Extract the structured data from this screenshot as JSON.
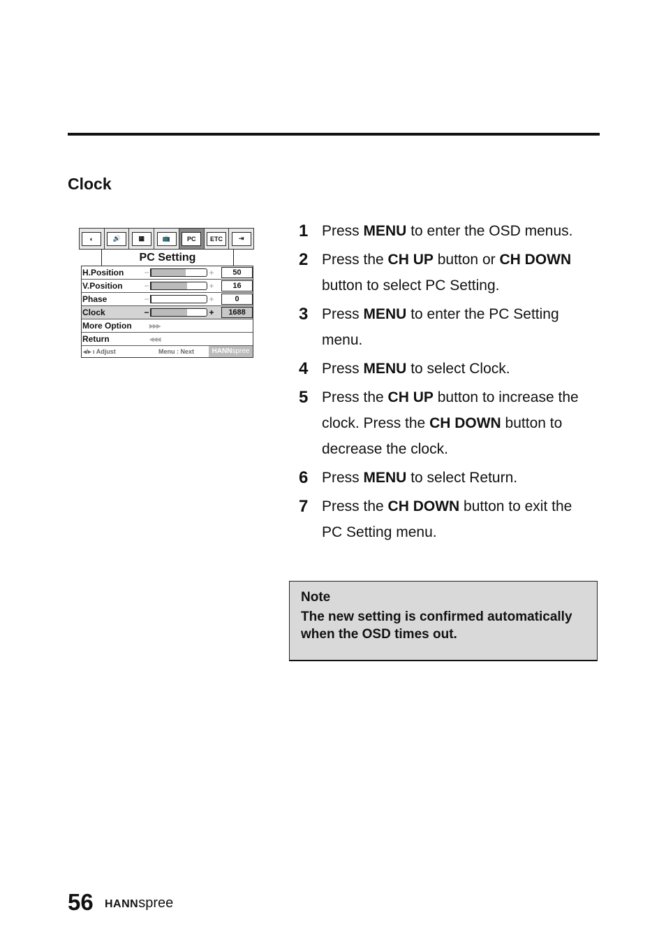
{
  "section_title": "Clock",
  "osd": {
    "tabs": [
      {
        "icon": "brightness-icon",
        "glyph": "◐",
        "active": false
      },
      {
        "icon": "sound-icon",
        "glyph": "🔊",
        "active": false
      },
      {
        "icon": "picture-icon",
        "glyph": "▦",
        "active": false
      },
      {
        "icon": "tv-icon",
        "glyph": "📺",
        "active": false
      },
      {
        "icon": "pc-icon",
        "glyph": "PC",
        "active": true
      },
      {
        "icon": "etc-icon",
        "glyph": "ETC",
        "active": false
      },
      {
        "icon": "exit-icon",
        "glyph": "⇥",
        "active": false
      }
    ],
    "title": "PC Setting",
    "rows": [
      {
        "label": "H.Position",
        "value": "50",
        "fill": 0.62,
        "selected": false
      },
      {
        "label": "V.Position",
        "value": "16",
        "fill": 0.64,
        "selected": false
      },
      {
        "label": "Phase",
        "value": "0",
        "fill": 0.0,
        "selected": false
      },
      {
        "label": "Clock",
        "value": "1688",
        "fill": 0.64,
        "selected": true
      }
    ],
    "more_option": "More Option",
    "return_label": "Return",
    "more_arrows": "▶▶▶",
    "return_arrows": "◀◀◀",
    "footer": {
      "adjust": "◂/▸ ı Adjust",
      "next": "Menu : Next",
      "brand_bold": "HANN",
      "brand_light": "spree"
    }
  },
  "steps": [
    {
      "num": "1",
      "parts": [
        [
          "Press ",
          false
        ],
        [
          "MENU",
          true
        ],
        [
          " to enter the OSD menus.",
          false
        ]
      ]
    },
    {
      "num": "2",
      "parts": [
        [
          "Press the ",
          false
        ],
        [
          "CH UP",
          true
        ],
        [
          " button or ",
          false
        ],
        [
          "CH DOWN",
          true
        ],
        [
          " button to select PC Setting.",
          false
        ]
      ]
    },
    {
      "num": "3",
      "parts": [
        [
          "Press ",
          false
        ],
        [
          "MENU",
          true
        ],
        [
          " to enter the PC Setting menu.",
          false
        ]
      ]
    },
    {
      "num": "4",
      "parts": [
        [
          "Press ",
          false
        ],
        [
          "MENU",
          true
        ],
        [
          " to select Clock.",
          false
        ]
      ]
    },
    {
      "num": "5",
      "parts": [
        [
          "Press the ",
          false
        ],
        [
          "CH UP",
          true
        ],
        [
          " button to increase the clock. Press the ",
          false
        ],
        [
          "CH DOWN",
          true
        ],
        [
          " button to decrease the clock.",
          false
        ]
      ]
    },
    {
      "num": "6",
      "parts": [
        [
          "Press ",
          false
        ],
        [
          "MENU",
          true
        ],
        [
          " to select Return.",
          false
        ]
      ]
    },
    {
      "num": "7",
      "parts": [
        [
          "Press the ",
          false
        ],
        [
          "CH DOWN",
          true
        ],
        [
          " button to exit the PC Setting menu.",
          false
        ]
      ]
    }
  ],
  "note": {
    "title": "Note",
    "body": "The new setting is confirmed automatically when the OSD times out."
  },
  "footer": {
    "page_number": "56",
    "brand_bold": "HANN",
    "brand_light": "spree"
  }
}
